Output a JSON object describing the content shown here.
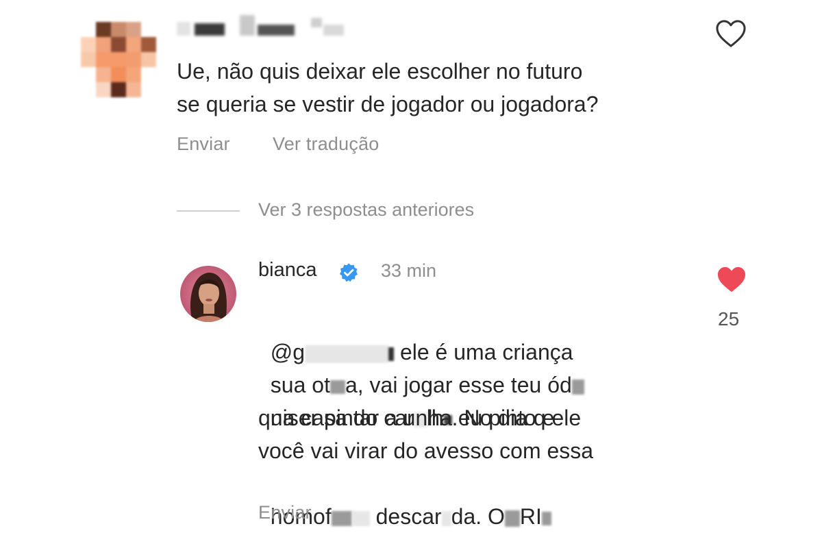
{
  "comment": {
    "text_lines": [
      "Ue, não quis deixar ele escolher no futuro",
      "se queria se vestir de jogador ou jogadora?"
    ],
    "actions": {
      "send": "Enviar",
      "translate": "Ver tradução"
    },
    "like_icon": "heart-outline-icon"
  },
  "replies_toggle": {
    "label": "Ver 3 respostas anteriores"
  },
  "reply": {
    "username": "bianca",
    "verified_icon": "verified-badge-icon",
    "time": "33 min",
    "like_count": "25",
    "like_icon": "heart-filled-icon",
    "like_color": "#ed4956",
    "text_segments": [
      [
        "@g",
        "",
        " ele é uma criança"
      ],
      [
        "sua ot",
        "",
        "a, vai jogar esse teu ód",
        ""
      ],
      [
        "na casa do car",
        "",
        "lh",
        "",
        ". No dia q ele"
      ],
      [
        "quiser pintar a unha eu pinto e"
      ],
      [
        "você vai virar do avesso com essa"
      ],
      [
        "homof",
        "",
        "descar",
        "",
        "da. O",
        "",
        "RI",
        ""
      ]
    ],
    "actions": {
      "send": "Enviar"
    }
  },
  "colors": {
    "text": "#262626",
    "secondary": "#8e8e8e",
    "verified": "#3897f0"
  }
}
